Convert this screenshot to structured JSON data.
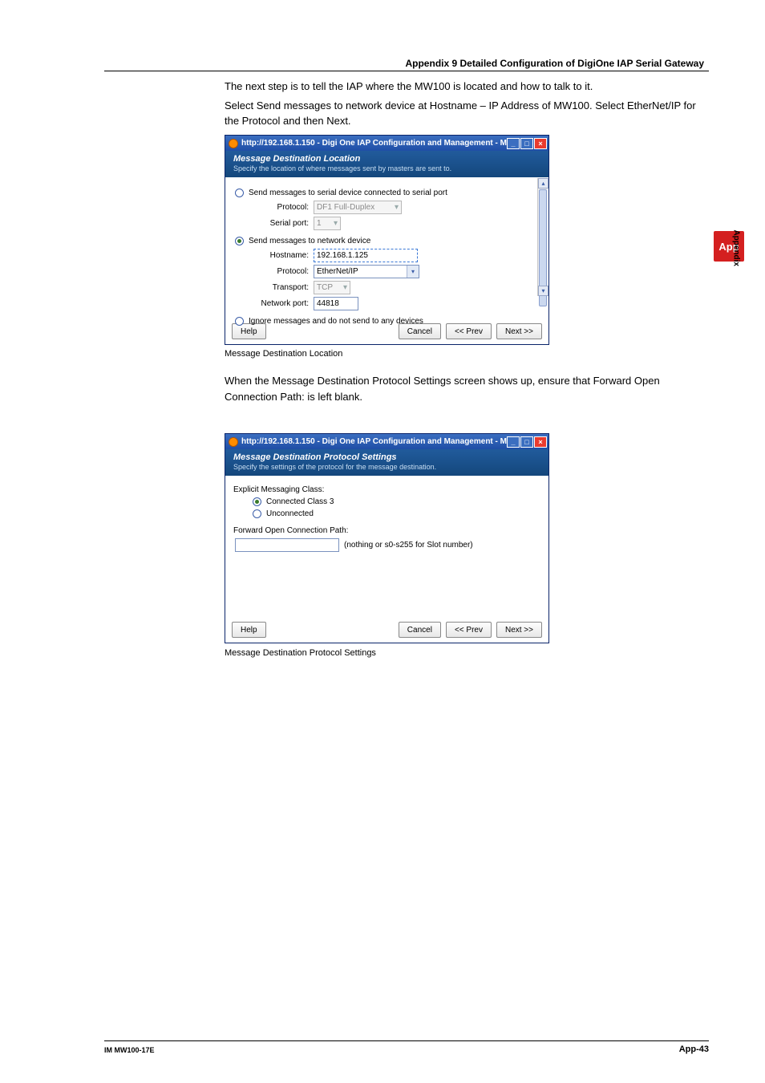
{
  "header": {
    "title": "Appendix 9  Detailed Configuration of DigiOne IAP Serial Gateway"
  },
  "intro": {
    "p1": "The next step is to tell the IAP where the MW100 is located and how to talk to it.",
    "p2": "Select Send messages to network device at Hostname – IP Address of MW100. Select EtherNet/IP for the Protocol and then Next."
  },
  "fig1": {
    "window_title": "http://192.168.1.150 - Digi One IAP Configuration and Management - Mozilla F...",
    "band_title": "Message Destination Location",
    "band_desc": "Specify the location of where messages sent by masters are sent to.",
    "opt_serial": "Send messages to serial device connected to serial port",
    "serial_protocol_label": "Protocol:",
    "serial_protocol_value": "DF1 Full-Duplex",
    "serial_port_label": "Serial port:",
    "serial_port_value": "1",
    "opt_network": "Send messages to network device",
    "hostname_label": "Hostname:",
    "hostname_value": "192.168.1.125",
    "protocol_label": "Protocol:",
    "protocol_value": "EtherNet/IP",
    "transport_label": "Transport:",
    "transport_value": "TCP",
    "netport_label": "Network port:",
    "netport_value": "44818",
    "opt_ignore": "Ignore messages and do not send to any devices",
    "help": "Help",
    "cancel": "Cancel",
    "prev": "<< Prev",
    "next": "Next >>",
    "caption": "Message Destination Location"
  },
  "mid": {
    "p1": "When the Message Destination Protocol Settings screen shows up, ensure that Forward Open Connection Path: is left blank."
  },
  "fig2": {
    "window_title": "http://192.168.1.150 - Digi One IAP Configuration and Management - Mozilla F...",
    "band_title": "Message Destination Protocol Settings",
    "band_desc": "Specify the settings of the protocol for the message destination.",
    "emc_label": "Explicit Messaging Class:",
    "emc_opt1": "Connected Class 3",
    "emc_opt2": "Unconnected",
    "focp_label": "Forward Open Connection Path:",
    "focp_hint": "(nothing or s0-s255 for Slot number)",
    "help": "Help",
    "cancel": "Cancel",
    "prev": "<< Prev",
    "next": "Next >>",
    "caption": "Message Destination Protocol Settings"
  },
  "side": {
    "tab": "App",
    "label": "Appendix"
  },
  "footer": {
    "left": "IM MW100-17E",
    "right": "App-43"
  }
}
